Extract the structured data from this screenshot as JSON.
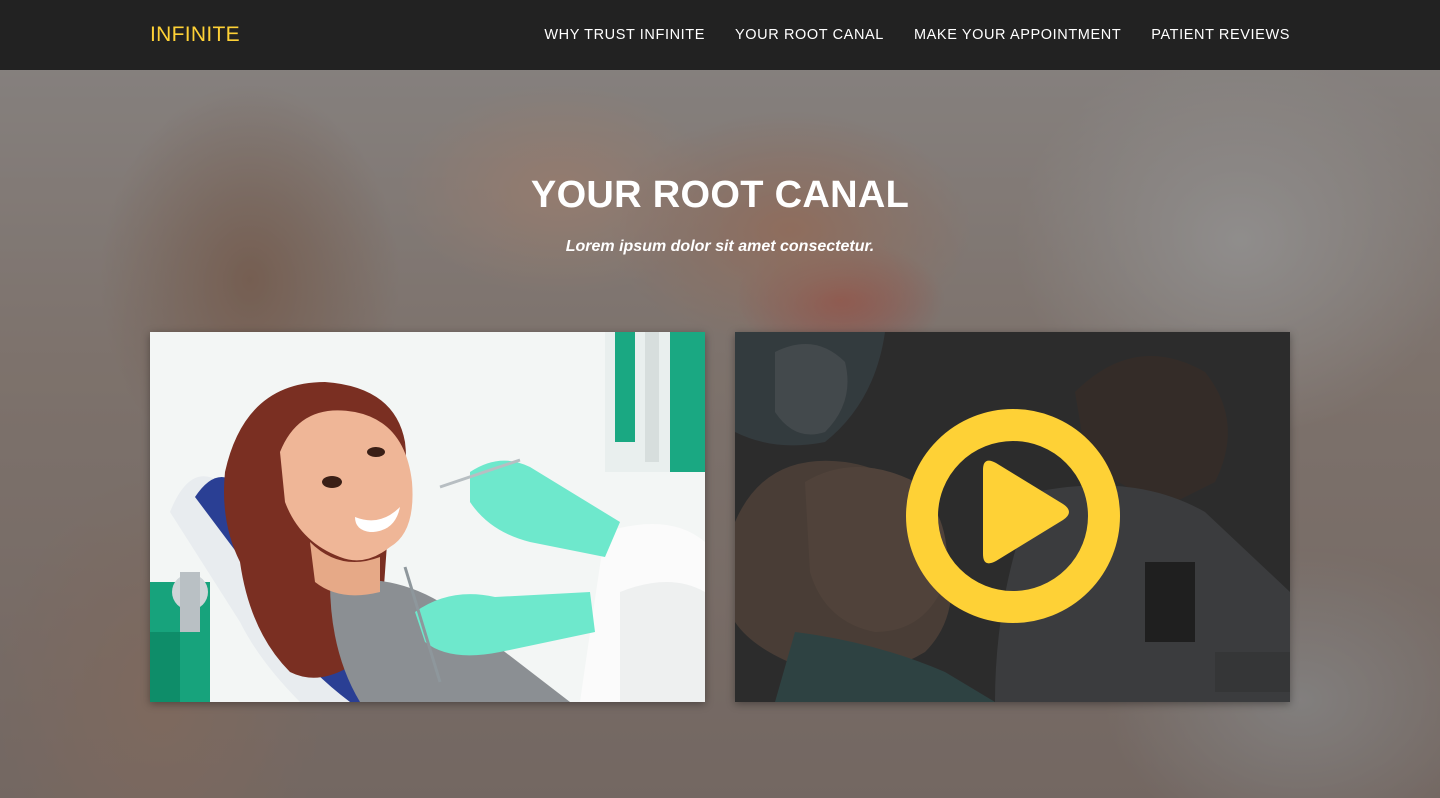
{
  "nav": {
    "brand": "INFINITE",
    "items": [
      {
        "label": "WHY TRUST INFINITE"
      },
      {
        "label": "YOUR ROOT CANAL"
      },
      {
        "label": "MAKE YOUR APPOINTMENT"
      },
      {
        "label": "PATIENT REVIEWS"
      }
    ]
  },
  "section": {
    "heading": "YOUR ROOT CANAL",
    "subheading": "Lorem ipsum dolor sit amet consectetur."
  },
  "colors": {
    "brand": "#fed136",
    "nav_background": "#222222",
    "play_button": "#fed136"
  },
  "media": {
    "photo_icon": "patient-in-dental-chair-image",
    "video_icon": "play-icon"
  }
}
